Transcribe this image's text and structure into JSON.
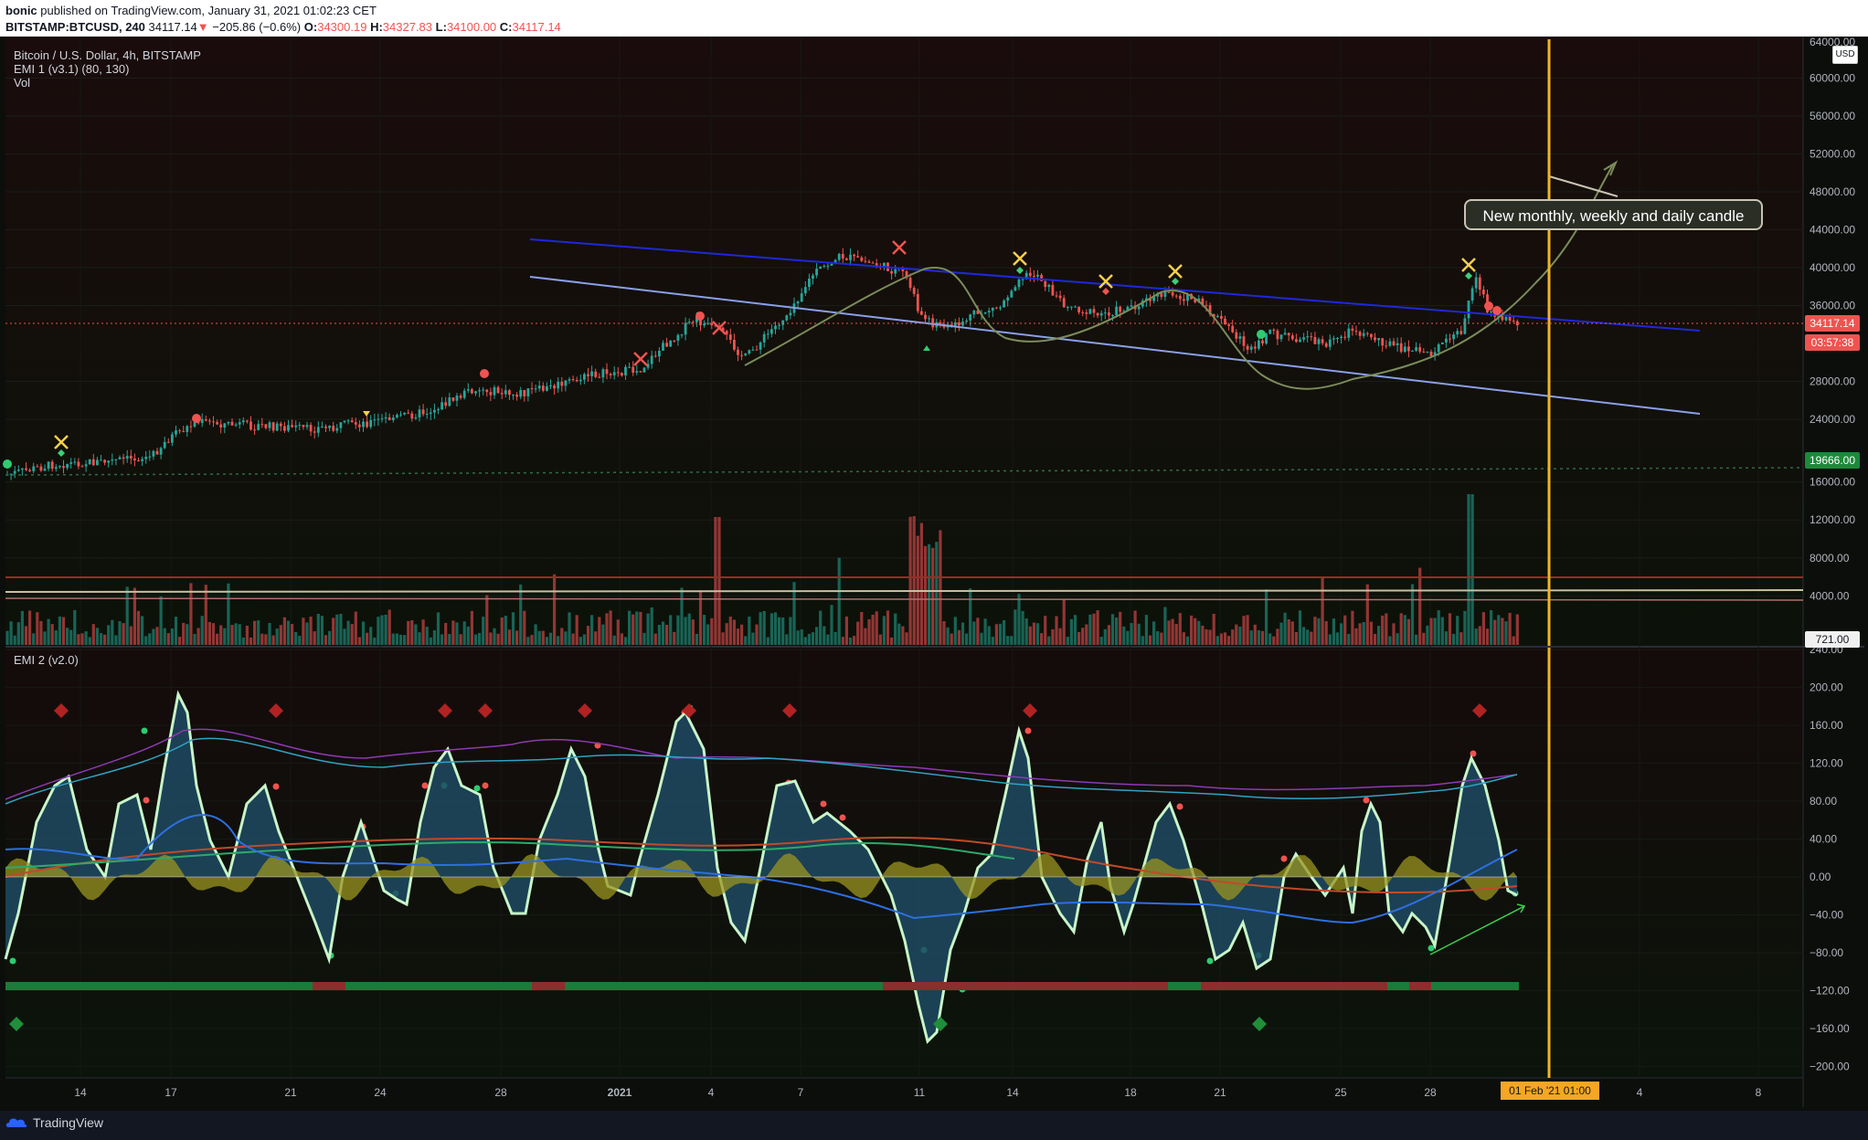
{
  "header": {
    "author": "bonic",
    "published_text": "published on TradingView.com, January 31, 2021 01:02:23 CET",
    "symbol": "BITSTAMP:BTCUSD, 240",
    "last": "34117.14",
    "change": "−205.86 (−0.6%)",
    "o_label": "O:",
    "o_value": "34300.19",
    "h_label": "H:",
    "h_value": "34327.83",
    "l_label": "L:",
    "l_value": "34100.00",
    "c_label": "C:",
    "c_value": "34117.14"
  },
  "legend": {
    "title": "Bitcoin / U.S. Dollar, 4h, BITSTAMP",
    "ind1": "EMI 1 (v3.1) (80, 130)",
    "vol": "Vol",
    "ind2": "EMI 2 (v2.0)"
  },
  "price_axis": {
    "currency": "USD",
    "top_label": "64000.00",
    "ticks": [
      "60000.00",
      "56000.00",
      "52000.00",
      "48000.00",
      "44000.00",
      "40000.00",
      "36000.00",
      "28000.00",
      "24000.00",
      "16000.00",
      "12000.00",
      "8000.00",
      "4000.00"
    ],
    "last_price": "34117.14",
    "countdown": "03:57:38",
    "level_label": "19666.00",
    "vol_label": "721.00"
  },
  "osc_axis": {
    "ticks": [
      "240.00",
      "200.00",
      "160.00",
      "120.00",
      "80.00",
      "40.00",
      "0.00",
      "−40.00",
      "−80.00",
      "−120.00",
      "−160.00",
      "−200.00"
    ]
  },
  "time_axis": {
    "ticks": [
      "14",
      "17",
      "21",
      "24",
      "28",
      "2021",
      "4",
      "7",
      "11",
      "14",
      "18",
      "21",
      "25",
      "28",
      "4",
      "8"
    ],
    "highlight": "01 Feb '21   01:00"
  },
  "annotation": {
    "text": "New monthly, weekly and daily candle"
  },
  "footer": {
    "brand": "TradingView"
  },
  "colors": {
    "up": "#26a69a",
    "down": "#ef5350",
    "channel_upper": "#1f28d9",
    "channel_lower": "#8aa0e8",
    "vertical_line": "#f0b429",
    "accent_green": "#089981"
  }
}
